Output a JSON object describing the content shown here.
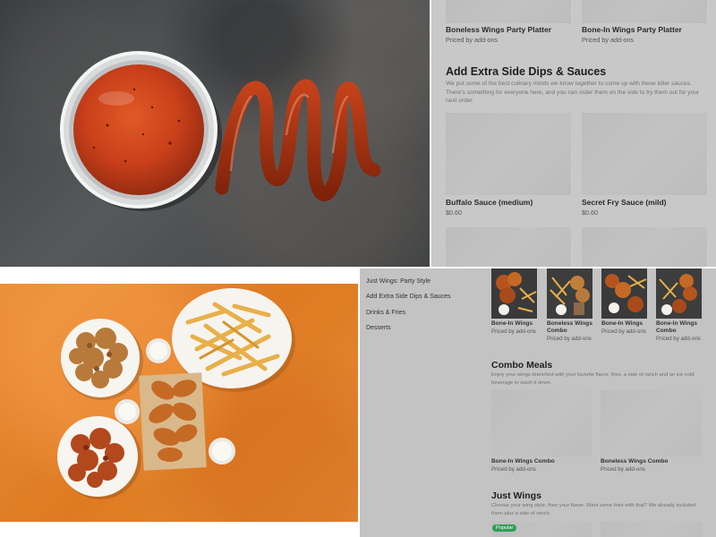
{
  "top_right": {
    "platters": [
      {
        "name": "Boneless Wings Party Platter",
        "price": "Priced by add-ons"
      },
      {
        "name": "Bone-In Wings Party Platter",
        "price": "Priced by add-ons"
      }
    ],
    "section_title": "Add Extra Side Dips & Sauces",
    "section_desc": "We put some of the best culinary minds we know together to come up with these killer sauces. There's something for everyone here, and you can order them on the side to try them out for your next order.",
    "items": [
      {
        "name": "Buffalo Sauce (medium)",
        "price": "$0.60"
      },
      {
        "name": "Secret Fry Sauce (mild)",
        "price": "$0.60"
      }
    ]
  },
  "bottom_right": {
    "sidebar": [
      {
        "label": "Just Wings: Party Style"
      },
      {
        "label": "Add Extra Side Dips & Sauces"
      },
      {
        "label": "Drinks & Fries"
      },
      {
        "label": "Desserts"
      }
    ],
    "thumbs": [
      {
        "name": "Bone-In Wings",
        "price": "Priced by add-ons"
      },
      {
        "name": "Boneless Wings Combo",
        "price": "Priced by add-ons"
      },
      {
        "name": "Bone-In Wings",
        "price": "Priced by add-ons"
      },
      {
        "name": "Bone-In Wings Combo",
        "price": "Priced by add-ons"
      }
    ],
    "combo_title": "Combo Meals",
    "combo_desc": "Enjoy your wings drenched with your favorite flavor, fries, a side of ranch and an ice cold beverage to wash it down.",
    "combo_items": [
      {
        "name": "Bone-In Wings Combo",
        "price": "Priced by add-ons"
      },
      {
        "name": "Boneless Wings Combo",
        "price": "Priced by add-ons"
      }
    ],
    "wings_title": "Just Wings",
    "wings_desc": "Choose your wing style, then your flavor. Want some fries with that? We already included them plus a side of ranch.",
    "popular_badge": "Popular"
  },
  "colors": {
    "placeholder_gray": "#bdbdbd",
    "popular_green": "#2f9e57",
    "sauce_red": "#c9401a",
    "orange_backdrop": "#e3822c"
  }
}
